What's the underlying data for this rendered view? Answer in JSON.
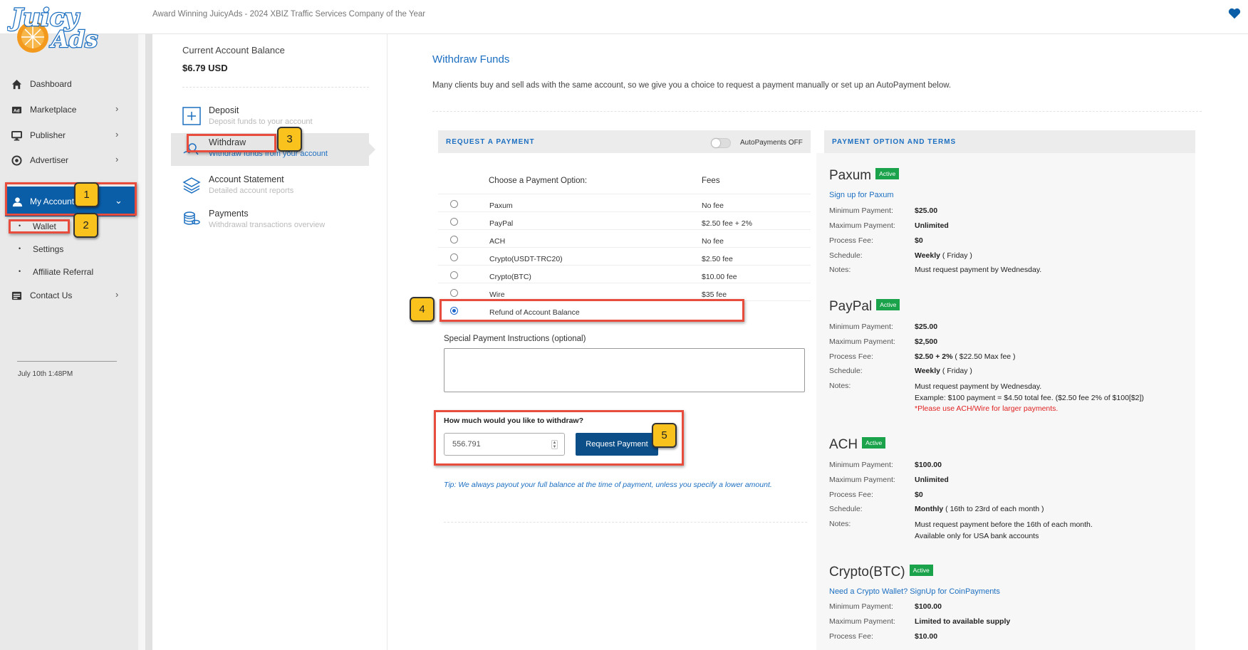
{
  "header": {
    "tagline": "Award Winning JuicyAds - 2024 XBIZ Traffic Services Company of the Year",
    "logo_text": "JuicyAds"
  },
  "sidebar": {
    "items": [
      {
        "label": "Dashboard",
        "icon": "home-icon"
      },
      {
        "label": "Marketplace",
        "icon": "ad-icon",
        "chevron": "›"
      },
      {
        "label": "Publisher",
        "icon": "monitor-icon",
        "chevron": "›"
      },
      {
        "label": "Advertiser",
        "icon": "target-icon",
        "chevron": "›"
      },
      {
        "label": "My Account",
        "icon": "user-icon",
        "chevron": "⌄"
      },
      {
        "label": "Contact Us",
        "icon": "contact-icon",
        "chevron": "›"
      }
    ],
    "sub_items": [
      {
        "label": "Wallet"
      },
      {
        "label": "Settings"
      },
      {
        "label": "Affiliate Referral"
      }
    ],
    "timestamp": "July 10th 1:48PM"
  },
  "account": {
    "balance_title": "Current Account Balance",
    "balance_value": "$6.79 USD",
    "menu": [
      {
        "title": "Deposit",
        "subtitle": "Deposit funds to your account",
        "icon": "deposit-icon"
      },
      {
        "title": "Withdraw",
        "subtitle": "Withdraw funds from your account",
        "icon": "withdraw-icon"
      },
      {
        "title": "Account Statement",
        "subtitle": "Detailed account reports",
        "icon": "layers-icon"
      },
      {
        "title": "Payments",
        "subtitle": "Withdrawal transactions overview",
        "icon": "coins-icon"
      }
    ]
  },
  "main": {
    "title": "Withdraw Funds",
    "description": "Many clients buy and sell ads with the same account, so we give you a choice to request a payment manually or set up an AutoPayment below.",
    "request_panel": {
      "heading": "REQUEST A PAYMENT",
      "autopay_label": "AutoPayments OFF",
      "col_option": "Choose a Payment Option:",
      "col_fees": "Fees",
      "options": [
        {
          "name": "Paxum",
          "fee": "No fee"
        },
        {
          "name": "PayPal",
          "fee": "$2.50 fee + 2%"
        },
        {
          "name": "ACH",
          "fee": "No fee"
        },
        {
          "name": "Crypto(USDT-TRC20)",
          "fee": "$2.50 fee"
        },
        {
          "name": "Crypto(BTC)",
          "fee": "$10.00 fee"
        },
        {
          "name": "Wire",
          "fee": "$35 fee"
        },
        {
          "name": "Refund of Account Balance",
          "fee": ""
        }
      ],
      "selected_option": "Refund of Account Balance",
      "instructions_label": "Special Payment Instructions (optional)",
      "instructions_value": "",
      "withdraw_question": "How much would you like to withdraw?",
      "amount_value": "556.791",
      "request_button": "Request Payment",
      "tip": "Tip: We always payout your full balance at the time of payment, unless you specify a lower amount."
    },
    "terms_panel": {
      "heading": "PAYMENT OPTION AND TERMS",
      "labels": {
        "min": "Minimum Payment:",
        "max": "Maximum Payment:",
        "fee": "Process Fee:",
        "schedule": "Schedule:",
        "notes": "Notes:"
      },
      "badge": "Active",
      "paxum": {
        "name": "Paxum",
        "link": "Sign up for Paxum",
        "min": "$25.00",
        "max": "Unlimited",
        "fee": "$0",
        "schedule_bold": "Weekly",
        "schedule_extra": "( Friday )",
        "notes": "Must request payment by Wednesday."
      },
      "paypal": {
        "name": "PayPal",
        "min": "$25.00",
        "max": "$2,500",
        "fee_bold": "$2.50 + 2%",
        "fee_extra": "( $22.50 Max fee )",
        "schedule_bold": "Weekly",
        "schedule_extra": "( Friday )",
        "notes1": "Must request payment by Wednesday.",
        "notes2": "Example: $100 payment = $4.50 total fee. ($2.50 fee 2% of $100[$2])",
        "notes3": "*Please use ACH/Wire for larger payments."
      },
      "ach": {
        "name": "ACH",
        "min": "$100.00",
        "max": "Unlimited",
        "fee": "$0",
        "schedule_bold": "Monthly",
        "schedule_extra": "( 16th to 23rd of each month )",
        "notes1": "Must request payment before the 16th of each month.",
        "notes2": "Available only for USA bank accounts"
      },
      "btc": {
        "name": "Crypto(BTC)",
        "link": "Need a Crypto Wallet? SignUp for CoinPayments",
        "min": "$100.00",
        "max": "Limited to available supply",
        "fee": "$10.00"
      }
    }
  },
  "callouts": [
    "1",
    "2",
    "3",
    "4",
    "5"
  ],
  "colors": {
    "brand": "#0a5ea8",
    "link": "#1c6fc1",
    "active_badge": "#1aa34a",
    "callout": "#f9c21c",
    "highlight": "#e74c3c"
  }
}
